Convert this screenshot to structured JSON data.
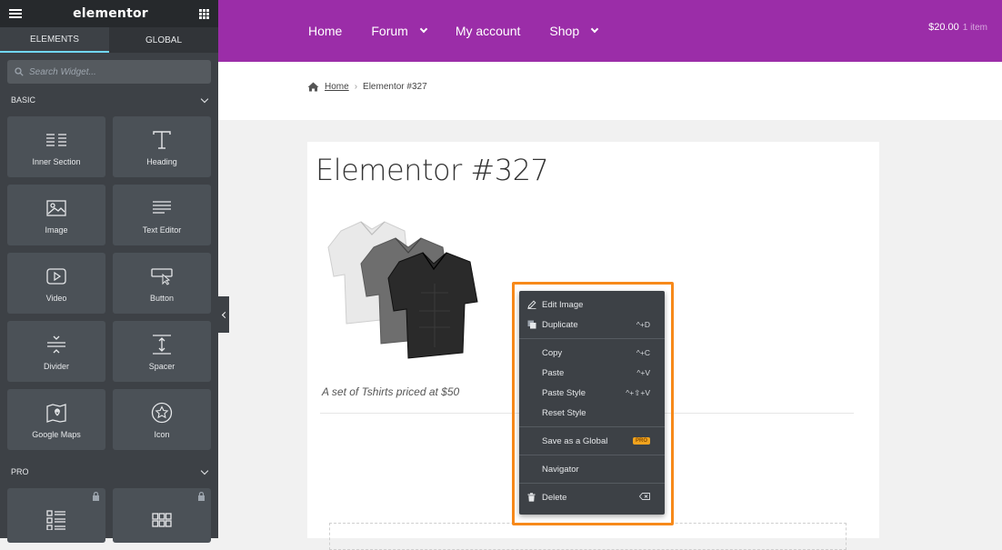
{
  "editor": {
    "brand": "elementor",
    "tabs": [
      {
        "label": "ELEMENTS",
        "active": true
      },
      {
        "label": "GLOBAL",
        "active": false
      }
    ],
    "search_placeholder": "Search Widget...",
    "sections": {
      "basic": "BASIC",
      "pro": "PRO"
    },
    "basic_widgets": [
      {
        "label": "Inner Section",
        "icon": "inner-section-icon"
      },
      {
        "label": "Heading",
        "icon": "heading-icon"
      },
      {
        "label": "Image",
        "icon": "image-icon"
      },
      {
        "label": "Text Editor",
        "icon": "text-editor-icon"
      },
      {
        "label": "Video",
        "icon": "video-icon"
      },
      {
        "label": "Button",
        "icon": "button-icon"
      },
      {
        "label": "Divider",
        "icon": "divider-icon"
      },
      {
        "label": "Spacer",
        "icon": "spacer-icon"
      },
      {
        "label": "Google Maps",
        "icon": "google-maps-icon"
      },
      {
        "label": "Icon",
        "icon": "star-icon"
      }
    ],
    "pro_widgets": [
      {
        "icon": "posts-icon",
        "locked": true
      },
      {
        "icon": "portfolio-icon",
        "locked": true
      }
    ]
  },
  "site": {
    "nav": [
      {
        "label": "Home",
        "has_dropdown": false
      },
      {
        "label": "Forum",
        "has_dropdown": true
      },
      {
        "label": "My account",
        "has_dropdown": false
      },
      {
        "label": "Shop",
        "has_dropdown": true
      }
    ],
    "cart": {
      "total": "$20.00",
      "count": "1 item"
    },
    "breadcrumb": {
      "home": "Home",
      "current": "Elementor #327"
    },
    "page_title": "Elementor #327",
    "caption": "A set of Tshirts priced at $50",
    "colors": {
      "header": "#9b2da8",
      "highlight": "#f7891a",
      "panel": "#3d4146"
    }
  },
  "context_menu": {
    "groups": [
      [
        {
          "label": "Edit Image",
          "icon": "pencil-icon",
          "shortcut": ""
        },
        {
          "label": "Duplicate",
          "icon": "duplicate-icon",
          "shortcut": "^+D"
        }
      ],
      [
        {
          "label": "Copy",
          "icon": "",
          "shortcut": "^+C"
        },
        {
          "label": "Paste",
          "icon": "",
          "shortcut": "^+V"
        },
        {
          "label": "Paste Style",
          "icon": "",
          "shortcut": "^+⇧+V"
        },
        {
          "label": "Reset Style",
          "icon": "",
          "shortcut": ""
        }
      ],
      [
        {
          "label": "Save as a Global",
          "icon": "",
          "badge": "PRO"
        }
      ],
      [
        {
          "label": "Navigator",
          "icon": ""
        }
      ],
      [
        {
          "label": "Delete",
          "icon": "trash-icon",
          "shortcut_icon": "backspace-icon"
        }
      ]
    ]
  }
}
